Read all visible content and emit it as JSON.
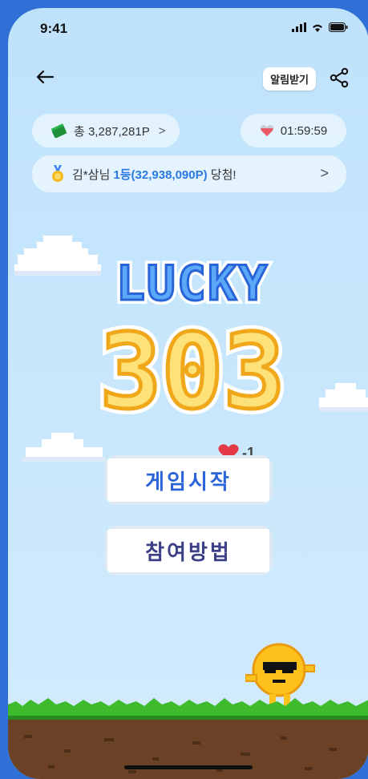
{
  "status_bar": {
    "time": "9:41"
  },
  "header": {
    "notify_label": "알림받기"
  },
  "points": {
    "label": "총 3,287,281P",
    "chevron": ">"
  },
  "timer": {
    "value": "01:59:59"
  },
  "winner": {
    "prefix": "김*삼님 ",
    "highlight": "1등(32,938,090P)",
    "suffix": " 당첨!",
    "chevron": ">"
  },
  "logo": {
    "line1": "LUCKY",
    "line2": "303"
  },
  "start": {
    "label": "게임시작",
    "cost": "-1"
  },
  "how": {
    "label": "참여방법"
  },
  "colors": {
    "sky": "#c8e7fc",
    "accent": "#2a7ae2",
    "grass": "#3dbb2d",
    "dirt": "#6b4226",
    "coin": "#f7c220"
  }
}
